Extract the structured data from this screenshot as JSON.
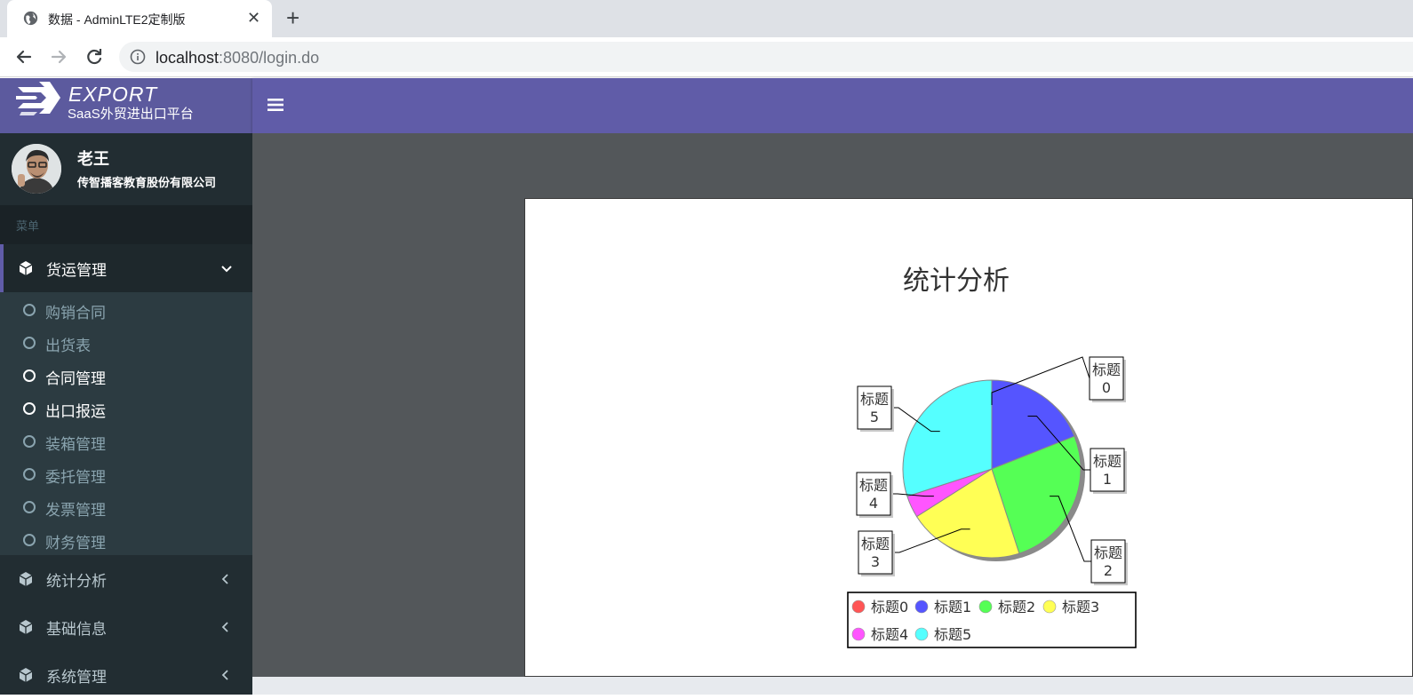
{
  "browser": {
    "tab_title": "数据 - AdminLTE2定制版",
    "url_host": "localhost",
    "url_rest": ":8080/login.do"
  },
  "logo": {
    "title": "EXPORT",
    "subtitle": "SaaS外贸进出口平台"
  },
  "user": {
    "name": "老王",
    "organization": "传智播客教育股份有限公司"
  },
  "menu": {
    "header": "菜单",
    "open_group": "货运管理",
    "submenu": [
      {
        "label": "购销合同",
        "active": false
      },
      {
        "label": "出货表",
        "active": false
      },
      {
        "label": "合同管理",
        "active": true
      },
      {
        "label": "出口报运",
        "active": true
      },
      {
        "label": "装箱管理",
        "active": false
      },
      {
        "label": "委托管理",
        "active": false
      },
      {
        "label": "发票管理",
        "active": false
      },
      {
        "label": "财务管理",
        "active": false
      }
    ],
    "groups": [
      "统计分析",
      "基础信息",
      "系统管理"
    ]
  },
  "colors": {
    "header_purple": "#605ca8",
    "sidebar_dark": "#222d32",
    "content_bg": "#53575a"
  },
  "chart_data": {
    "type": "pie",
    "title": "统计分析",
    "legend_placement": "bottom",
    "series": [
      {
        "name": "标题0",
        "label_line1": "标题",
        "label_line2": "0",
        "value": 0.001,
        "color": "#ff5555"
      },
      {
        "name": "标题1",
        "label_line1": "标题",
        "label_line2": "1",
        "value": 19,
        "color": "#5555ff"
      },
      {
        "name": "标题2",
        "label_line1": "标题",
        "label_line2": "2",
        "value": 26,
        "color": "#55ff55"
      },
      {
        "name": "标题3",
        "label_line1": "标题",
        "label_line2": "3",
        "value": 21,
        "color": "#ffff55"
      },
      {
        "name": "标题4",
        "label_line1": "标题",
        "label_line2": "4",
        "value": 4,
        "color": "#ff55ff"
      },
      {
        "name": "标题5",
        "label_line1": "标题",
        "label_line2": "5",
        "value": 30,
        "color": "#55ffff"
      }
    ]
  }
}
